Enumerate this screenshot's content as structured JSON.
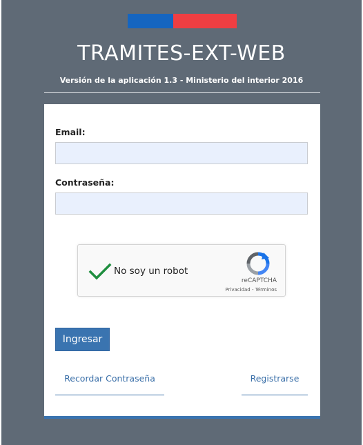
{
  "header": {
    "app_title": "TRAMITES-EXT-WEB",
    "subtitle": "Versión de la aplicación 1.3 - Ministerio del interior 2016"
  },
  "form": {
    "email_label": "Email:",
    "email_value": "",
    "password_label": "Contraseña:",
    "password_value": "",
    "submit_label": "Ingresar"
  },
  "captcha": {
    "checkbox_label": "No soy un robot",
    "checked": true,
    "brand": "reCAPTCHA",
    "links": "Privacidad - Términos"
  },
  "footer_links": {
    "recover_password": "Recordar Contraseña",
    "register": "Registrarse"
  },
  "colors": {
    "background": "#5f6a76",
    "flag_blue": "#1565c0",
    "flag_red": "#ef3e42",
    "accent": "#3a74b0",
    "input_bg": "#e9f0fd",
    "check_green": "#1e8e3e"
  }
}
